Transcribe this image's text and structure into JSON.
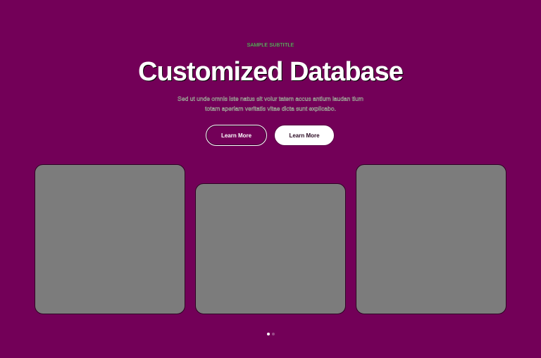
{
  "hero": {
    "subtitle": "SAMPLE SUBTITLE",
    "title": "Customized Database",
    "description_line1": "Sed ut unde omnis iste natus sit volur tatem accus antium laudan tium",
    "description_line2": "totam aperiam veritatis vitae dicta sunt explicabo.",
    "primary_button_label": "Learn More",
    "secondary_button_label": "Learn More"
  },
  "carousel": {
    "cards": [
      {
        "label": ""
      },
      {
        "label": ""
      },
      {
        "label": ""
      }
    ],
    "pagination": {
      "total": 2,
      "active_index": 0
    }
  },
  "colors": {
    "background": "#730058",
    "card": "#7c7c7c",
    "button_solid_bg": "#ffffff",
    "text_primary": "#ffffff"
  }
}
